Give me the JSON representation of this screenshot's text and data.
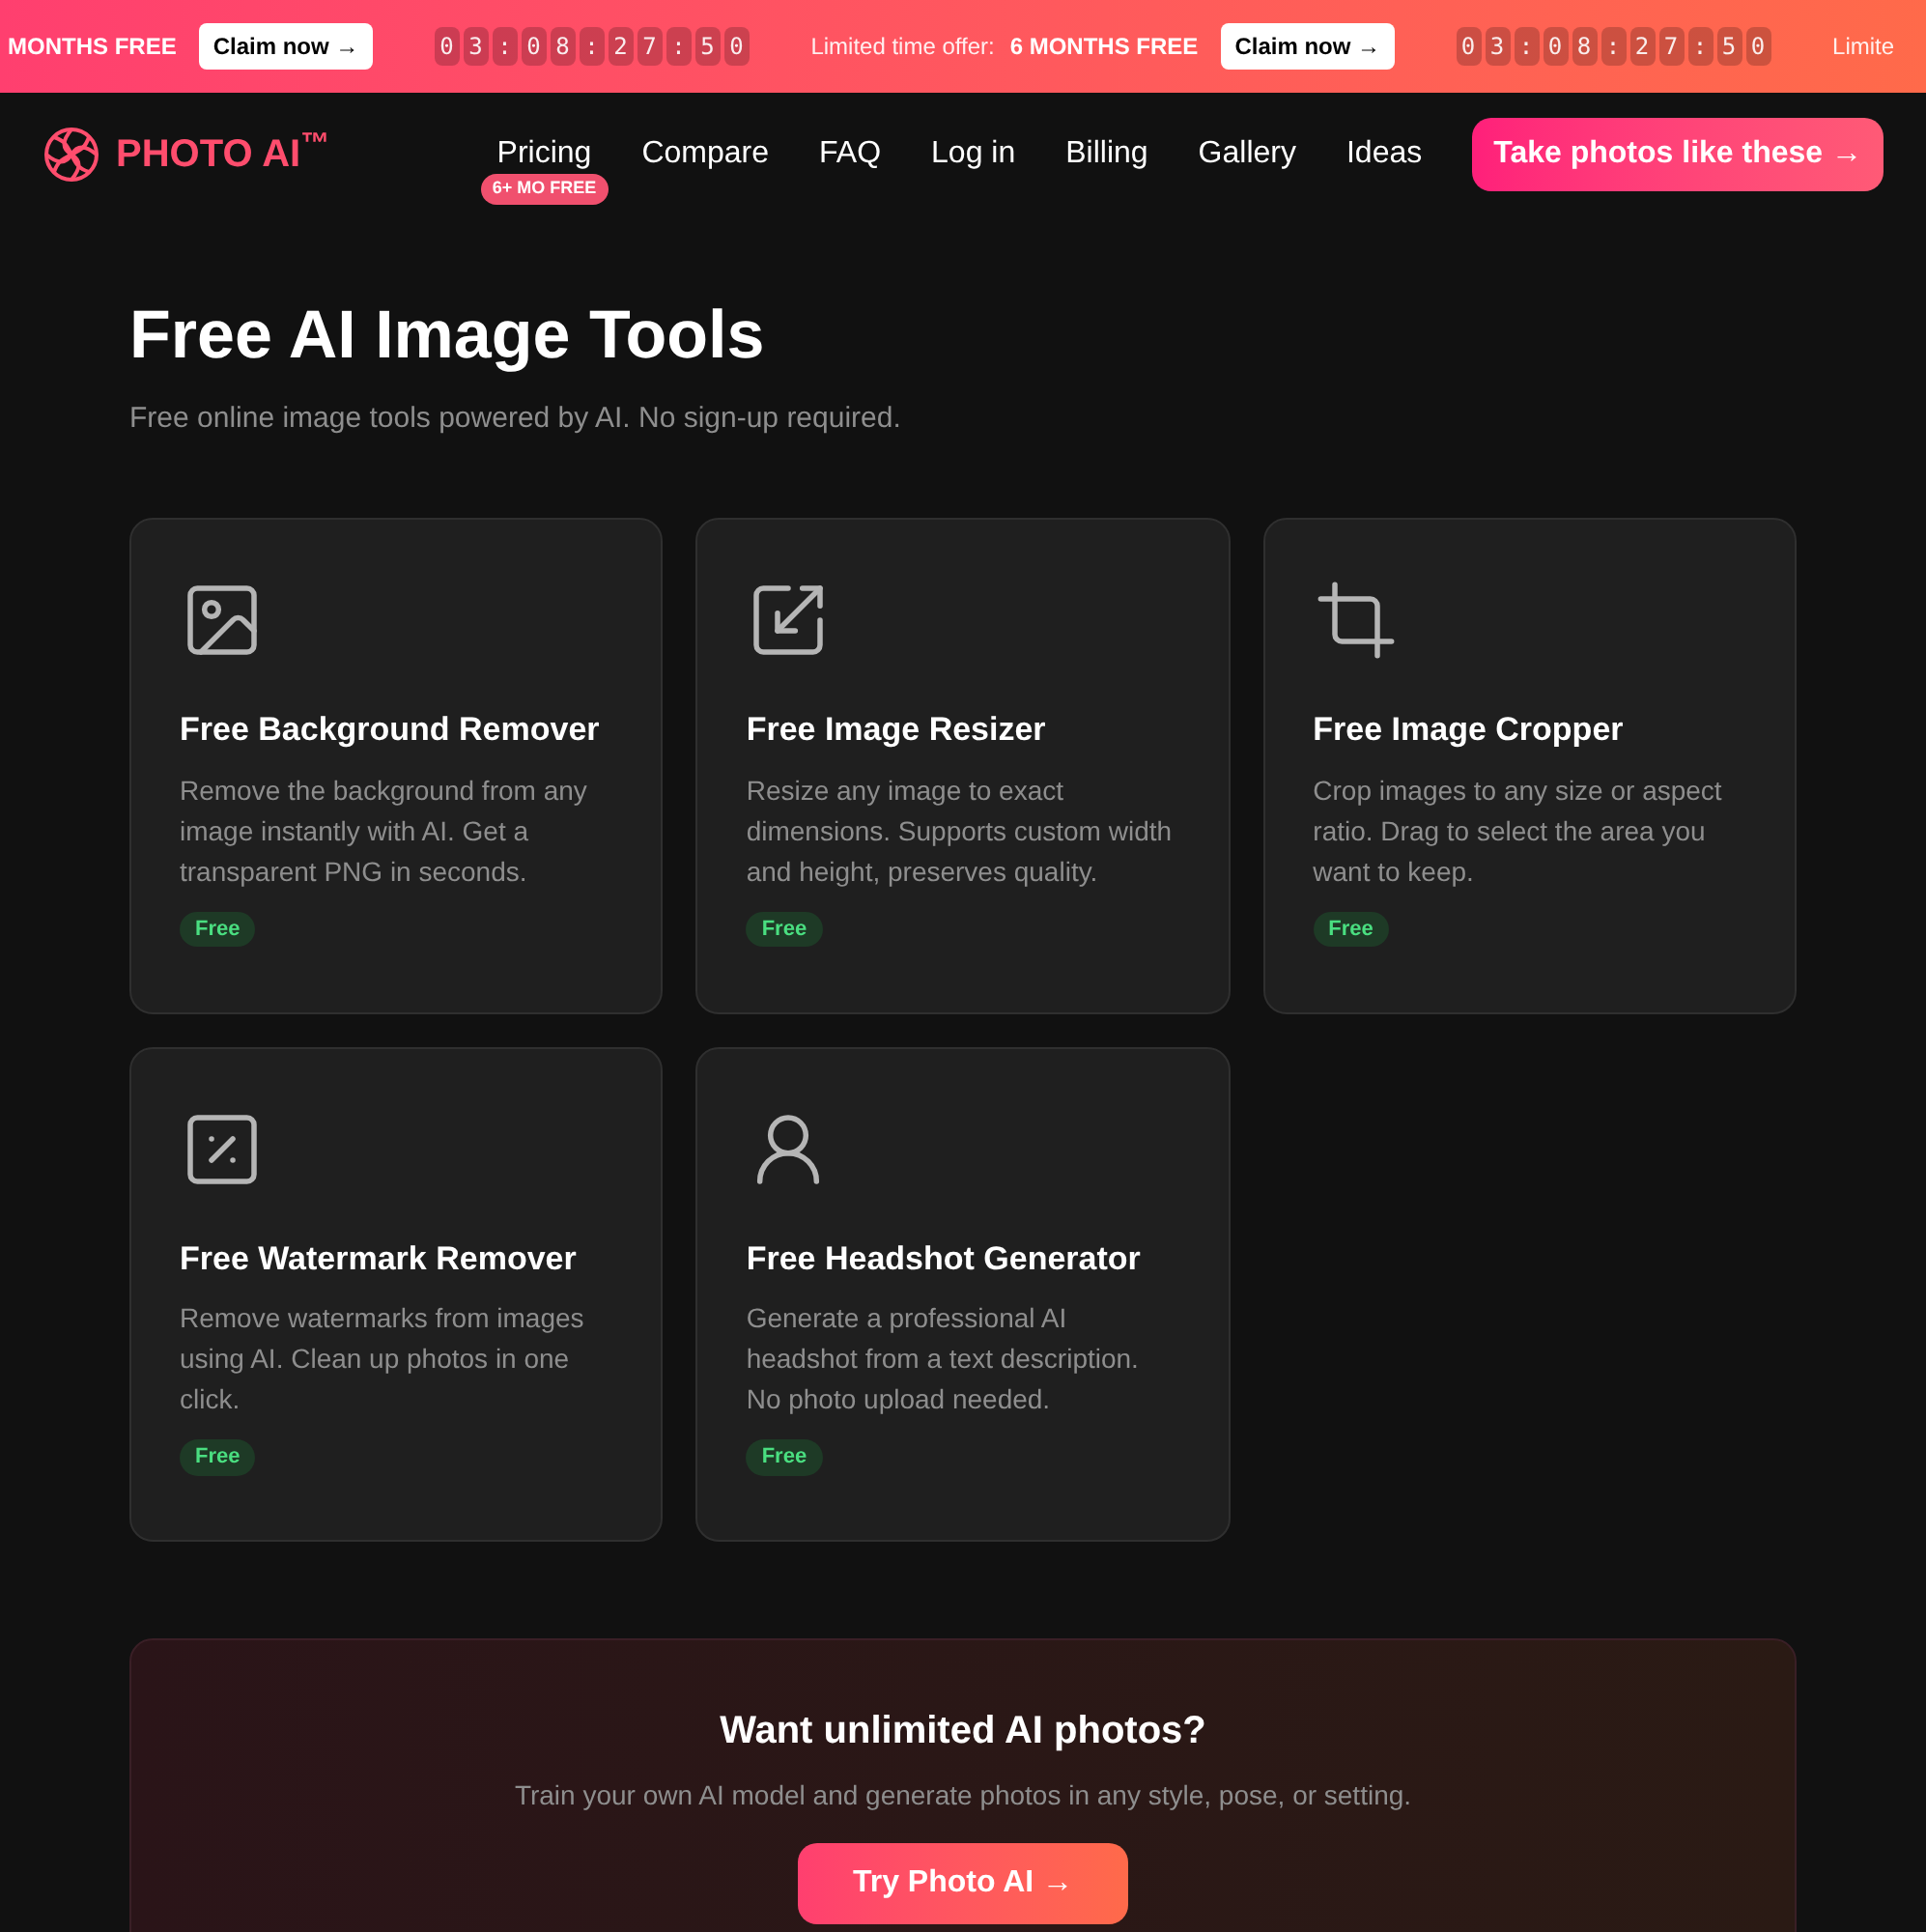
{
  "promo_bar": {
    "segments": [
      {
        "kind": "offer",
        "value": "MONTHS FREE"
      },
      {
        "kind": "button",
        "label": "Claim now →"
      },
      {
        "kind": "countdown",
        "chars": [
          "0",
          "3",
          ":",
          "0",
          "8",
          ":",
          "2",
          "7",
          ":",
          "5",
          "0"
        ]
      },
      {
        "kind": "offer",
        "label": "Limited time offer:",
        "value": "6 MONTHS FREE"
      },
      {
        "kind": "button",
        "label": "Claim now →"
      },
      {
        "kind": "countdown",
        "chars": [
          "0",
          "3",
          ":",
          "0",
          "8",
          ":",
          "2",
          "7",
          ":",
          "5",
          "0"
        ]
      },
      {
        "kind": "offer",
        "label": "Limite"
      }
    ]
  },
  "nav": {
    "logo": "PHOTO AI$^{™}$",
    "links": [
      {
        "label": "Pricing",
        "badge": "6+ MO FREE"
      },
      {
        "label": "Compare"
      },
      {
        "label": "FAQ"
      },
      {
        "label": "Log in"
      },
      {
        "label": "Billing"
      },
      {
        "label": "Gallery"
      },
      {
        "label": "Ideas"
      }
    ],
    "cta": "Take photos like these →"
  },
  "heading": "Free AI Image Tools",
  "subheading": "Free online image tools powered by AI. No sign-up required.",
  "tools": [
    {
      "kind": "image",
      "title": "Free Background Remover",
      "description": "Remove the background from any image instantly with AI. Get a transparent PNG in seconds.",
      "badge": "Free"
    },
    {
      "kind": "resize",
      "title": "Free Image Resizer",
      "description": "Resize any image to exact dimensions. Supports custom width and height, preserves quality.",
      "badge": "Free"
    },
    {
      "kind": "crop",
      "title": "Free Image Cropper",
      "description": "Crop images to any size or aspect ratio. Drag to select the area you want to keep.",
      "badge": "Free"
    },
    {
      "kind": "watermark",
      "title": "Free Watermark Remover",
      "description": "Remove watermarks from images using AI. Clean up photos in one click.",
      "badge": "Free"
    },
    {
      "kind": "user",
      "title": "Free Headshot Generator",
      "description": "Generate a professional AI headshot from a text description. No photo upload needed.",
      "badge": "Free"
    }
  ],
  "cta_panel": {
    "title": "Want unlimited AI photos?",
    "text": "Train your own AI model and generate photos in any style, pose, or setting.",
    "button": "Try Photo AI →"
  }
}
